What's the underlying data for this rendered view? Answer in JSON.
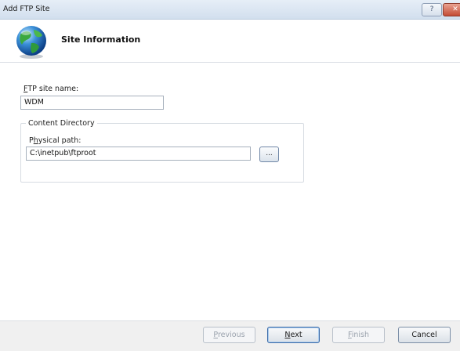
{
  "window": {
    "title": "Add FTP Site",
    "help_label": "?",
    "close_label": "✕"
  },
  "header": {
    "heading": "Site Information"
  },
  "form": {
    "ftp_site_name": {
      "label_access_key": "F",
      "label_rest": "TP site name:",
      "value": "WDM"
    },
    "content_directory": {
      "legend": "Content Directory",
      "physical_path": {
        "label_prefix": "P",
        "label_access_key": "h",
        "label_rest": "ysical path:",
        "value": "C:\\inetpub\\ftproot"
      },
      "browse_label": "..."
    }
  },
  "buttons": {
    "previous": {
      "access_key": "P",
      "rest": "revious",
      "enabled": false
    },
    "next": {
      "access_key": "N",
      "rest": "ext",
      "enabled": true
    },
    "finish": {
      "access_key": "F",
      "rest": "inish",
      "enabled": false
    },
    "cancel": {
      "label": "Cancel",
      "enabled": true
    }
  },
  "icons": {
    "header_icon": "globe-icon"
  },
  "colors": {
    "titlebar": "#d2dfee",
    "close_button": "#c34b34",
    "footer": "#f0f0f0"
  }
}
